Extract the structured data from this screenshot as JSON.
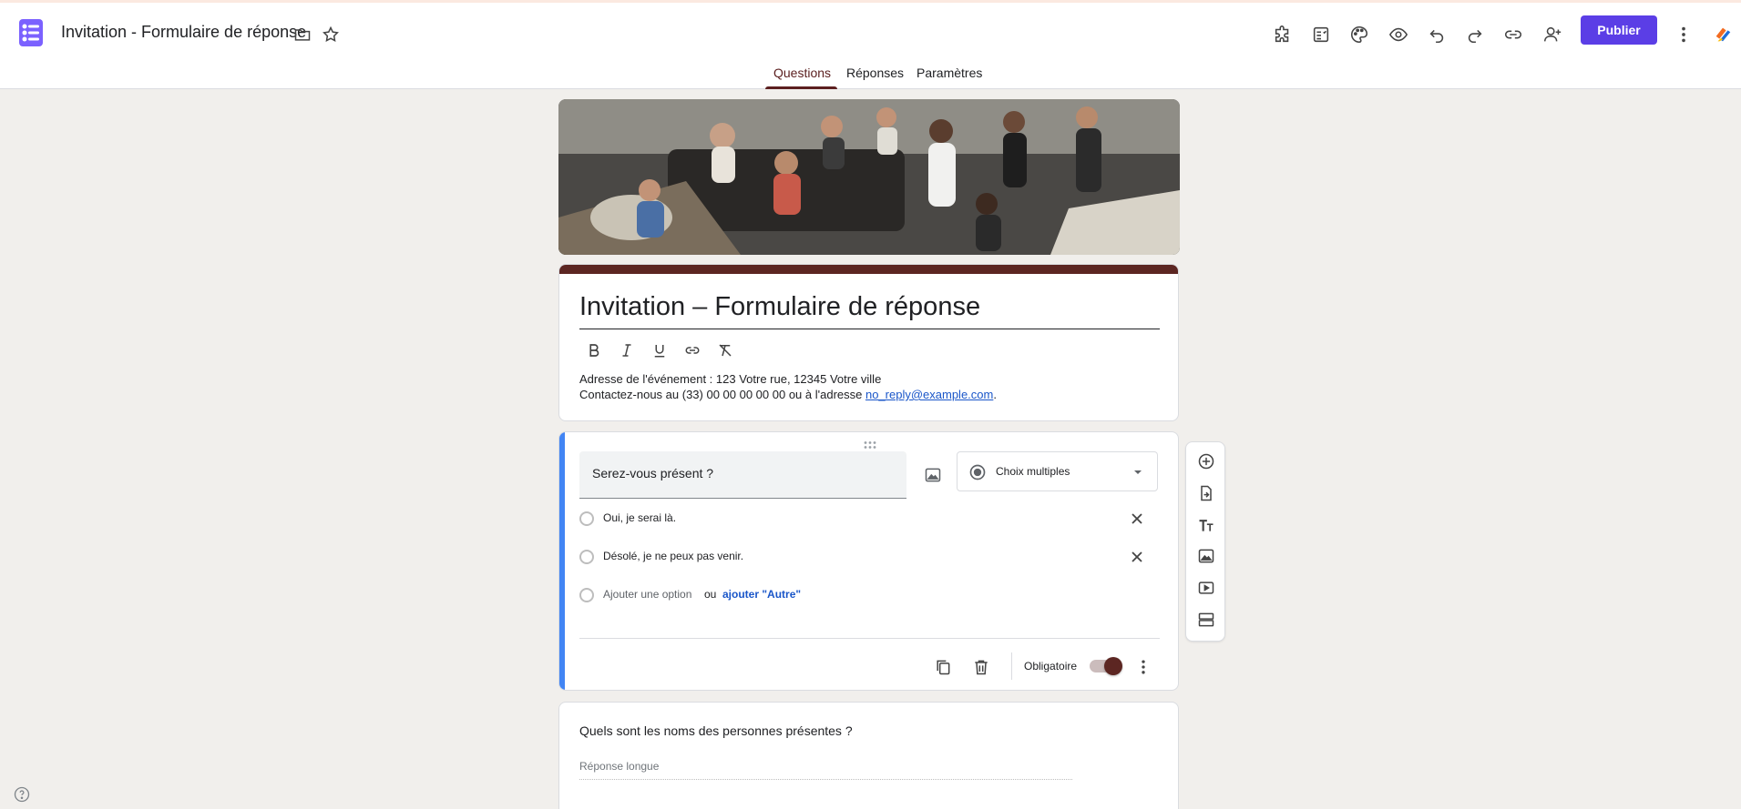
{
  "app": {
    "document_title": "Invitation - Formulaire de réponse",
    "logo_icon": "forms-logo-icon",
    "addon_icon": "multicolor-addon-icon"
  },
  "header": {
    "title_icons": [
      "folder-icon",
      "star-icon"
    ],
    "toolbar_icons": [
      "puzzle-icon",
      "quiz-settings-icon",
      "palette-icon",
      "preview-eye-icon",
      "undo-icon",
      "redo-icon",
      "link-icon",
      "add-collaborator-icon"
    ],
    "publish_label": "Publier",
    "more_icon": "more-vert-icon"
  },
  "tabs": [
    {
      "label": "Questions",
      "active": true
    },
    {
      "label": "Réponses",
      "active": false
    },
    {
      "label": "Paramètres",
      "active": false
    }
  ],
  "form": {
    "title": "Invitation – Formulaire de réponse",
    "format_icons": [
      "bold-icon",
      "italic-icon",
      "underline-icon",
      "link-icon",
      "clear-format-icon"
    ],
    "description_line1": "Adresse de l'événement : 123 Votre rue, 12345 Votre ville",
    "description_line2_prefix": "Contactez-nous au (33) 00 00 00 00 00 ou à l'adresse ",
    "description_email": "no_reply@example.com",
    "description_line2_suffix": "."
  },
  "question1": {
    "title": "Serez-vous présent ?",
    "type": "Choix multiples",
    "options": [
      "Oui, je serai là.",
      "Désolé, je ne peux pas venir."
    ],
    "add_option": "Ajouter une option",
    "or_text": "ou",
    "add_other": "ajouter \"Autre\"",
    "required_label": "Obligatoire",
    "required": true
  },
  "question2": {
    "title": "Quels sont les noms des personnes présentes ?",
    "answer_placeholder": "Réponse longue"
  },
  "side_toolbar": [
    "add-question-icon",
    "import-questions-icon",
    "add-title-icon",
    "add-image-icon",
    "add-video-icon",
    "add-section-icon"
  ],
  "colors": {
    "accent": "#5c2622",
    "publish": "#5b3ee6",
    "active_question": "#4285f4",
    "link": "#1a56c9",
    "background": "#f1efec"
  }
}
